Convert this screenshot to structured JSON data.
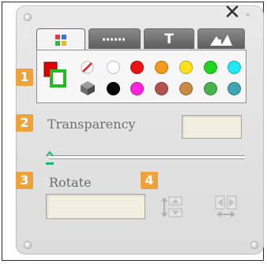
{
  "window": {
    "close_label": "✕",
    "minimize_label": "⌄"
  },
  "tabs": [
    {
      "name": "color-tab",
      "icon": "palette-grid-icon",
      "active": true
    },
    {
      "name": "line-style-tab",
      "icon": "dashed-line-icon",
      "active": false
    },
    {
      "name": "text-tab",
      "icon": "text-icon",
      "label": "T",
      "active": false
    },
    {
      "name": "shapes-tab",
      "icon": "shapes-icon",
      "active": false
    }
  ],
  "palette": {
    "current_colors": {
      "border": "#e00000",
      "fill": "#22bb22"
    },
    "row1": [
      "no-color",
      "#ffffff",
      "#ee1111",
      "#f39a1c",
      "#ffe11a",
      "#1fd51f",
      "#22e8f4"
    ],
    "row2": [
      "dark-cube",
      "#000000",
      "#ff22dd",
      "#b4514c",
      "#c98a44",
      "#46b34c",
      "#3ea7b5"
    ]
  },
  "badges": {
    "one": "1",
    "two": "2",
    "three": "3",
    "four": "4"
  },
  "transparency": {
    "label": "Transparency",
    "value": "",
    "slider_level": 0
  },
  "rotate": {
    "label": "Rotate",
    "value": ""
  },
  "icons": {
    "flip_vertical": "flip-vertical-icon",
    "flip_horizontal": "flip-horizontal-icon"
  }
}
